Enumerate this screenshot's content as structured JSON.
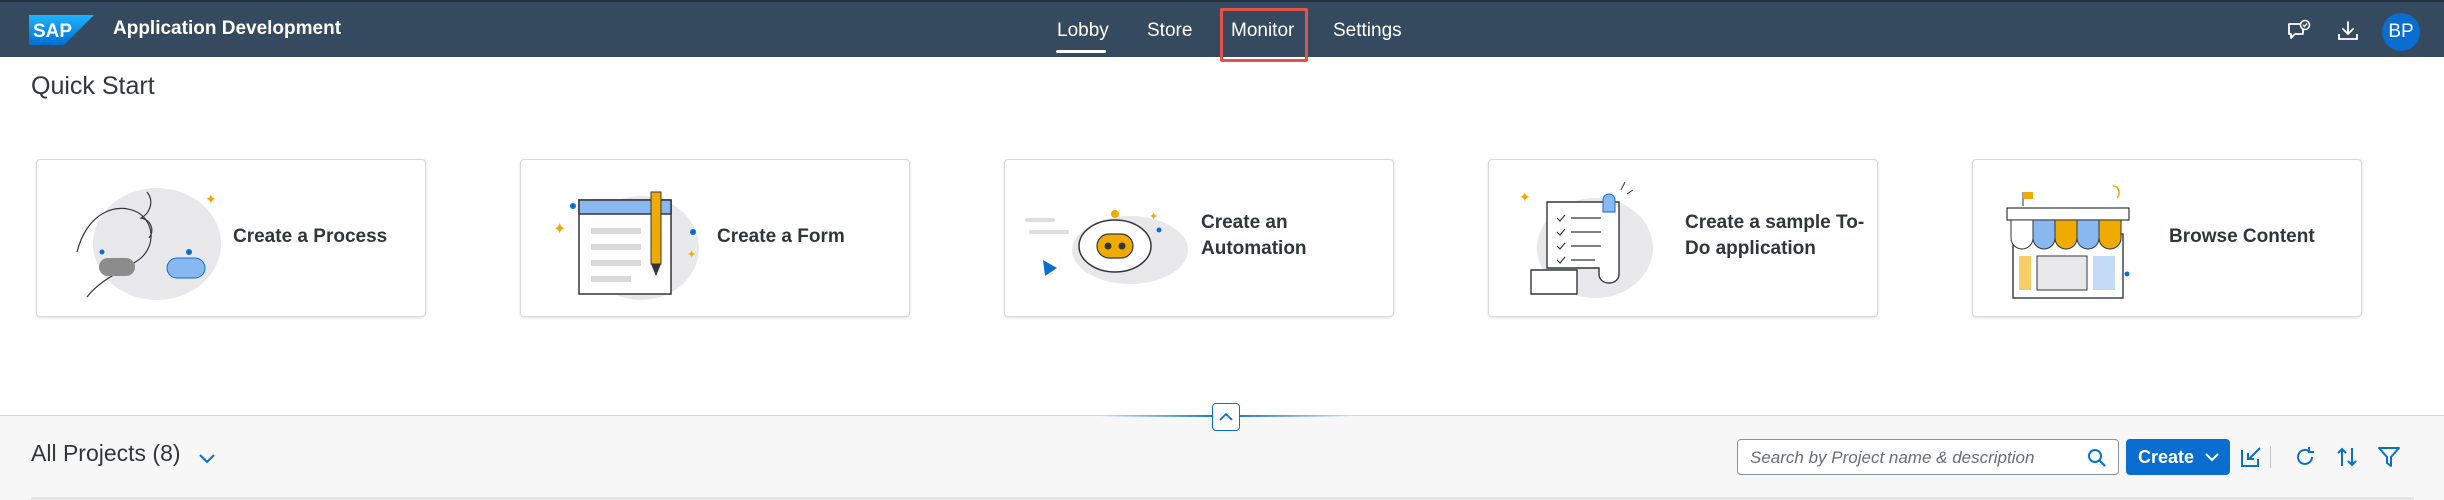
{
  "shell": {
    "logo_text": "SAP",
    "app_title": "Application Development",
    "nav": [
      {
        "label": "Lobby"
      },
      {
        "label": "Store"
      },
      {
        "label": "Monitor"
      },
      {
        "label": "Settings"
      }
    ],
    "active_nav": "Lobby",
    "highlighted_nav": "Monitor",
    "icons": [
      "feedback-icon",
      "download-icon"
    ],
    "avatar_initials": "BP"
  },
  "quick_start": {
    "title": "Quick Start",
    "cards": [
      {
        "label": "Create a Process"
      },
      {
        "label": "Create a Form"
      },
      {
        "label": "Create an Automation"
      },
      {
        "label": "Create a sample To-Do application"
      },
      {
        "label": "Browse Content"
      }
    ]
  },
  "projects": {
    "title": "All Projects (8)",
    "search_placeholder": "Search by Project name & description",
    "create_label": "Create",
    "tool_icons": [
      "import-icon",
      "refresh-icon",
      "sort-icon",
      "filter-icon"
    ]
  },
  "colors": {
    "shell_bg": "#354a5f",
    "accent": "#0a6ed1",
    "highlight": "#e5524a",
    "text": "#32363a"
  }
}
